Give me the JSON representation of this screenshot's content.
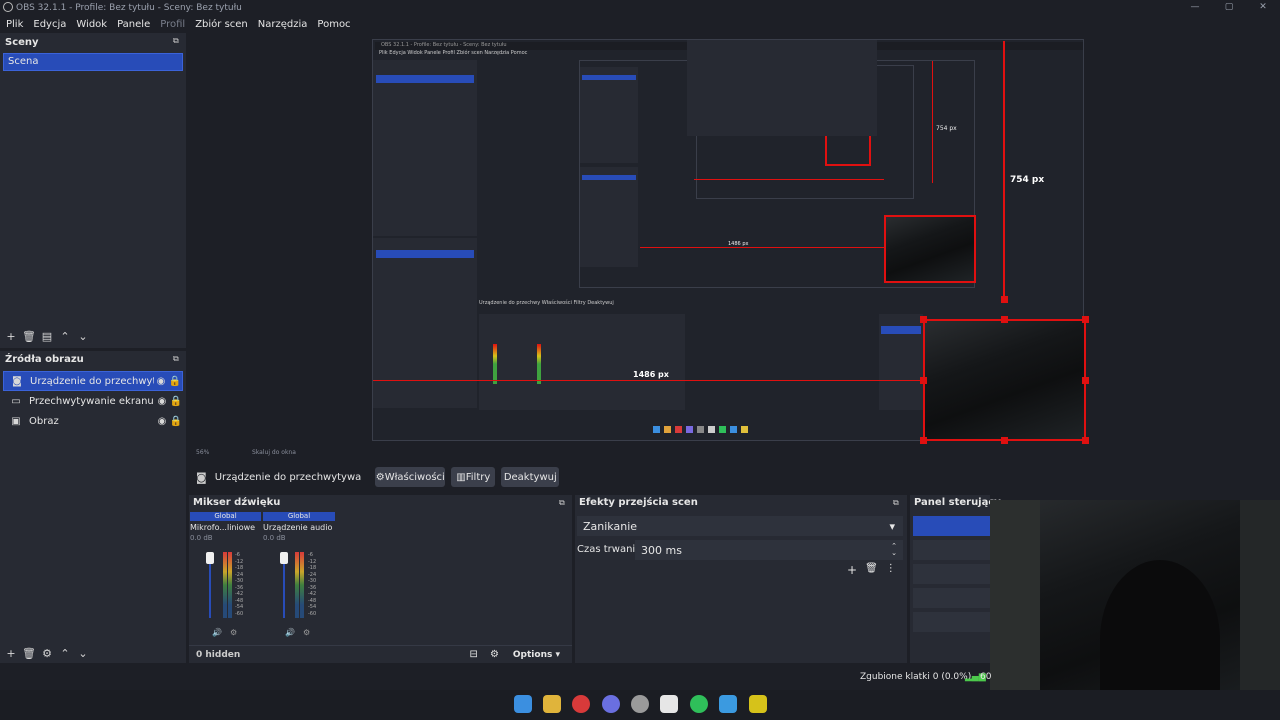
{
  "window": {
    "title": "OBS 32.1.1 - Profile: Bez tytułu - Sceny: Bez tytułu",
    "controls": [
      "—",
      "▢",
      "✕"
    ]
  },
  "menu": [
    "Plik",
    "Edycja",
    "Widok",
    "Panele",
    "Profil",
    "Zbiór scen",
    "Narzędzia",
    "Pomoc"
  ],
  "scenes": {
    "title": "Sceny",
    "items": [
      "Scena"
    ]
  },
  "sources": {
    "title": "Źródła obrazu",
    "items": [
      {
        "name": "Urządzenie do przechwytywan",
        "icon": "camera-icon"
      },
      {
        "name": "Przechwytywanie ekranu",
        "icon": "monitor-icon"
      },
      {
        "name": "Obraz",
        "icon": "image-icon"
      }
    ]
  },
  "preview": {
    "bottom_label": "Skaluj do okna",
    "zoom": "56%",
    "measure_height": "754 px",
    "measure_width": "1486 px",
    "inner_measure_height": "754 px",
    "inner_measure_width": "1486 px"
  },
  "context_bar": {
    "source": "Urządzenie do przechwytywa",
    "properties": "Właściwości",
    "filters": "Filtry",
    "deactivate": "Deaktywuj"
  },
  "mixer": {
    "title": "Mikser dźwięku",
    "channels": [
      {
        "badge": "Global",
        "name": "Mikrofo...liniowe",
        "db": "0.0 dB"
      },
      {
        "badge": "Global",
        "name": "Urządzenie audio",
        "db": "0.0 dB"
      }
    ],
    "scale": [
      "-6",
      "-12",
      "-18",
      "-24",
      "-30",
      "-36",
      "-42",
      "-48",
      "-54",
      "-60"
    ],
    "hidden": "0 hidden",
    "options": "Options"
  },
  "transitions": {
    "title": "Efekty przejścia scen",
    "selected": "Zanikanie",
    "duration_label": "Czas trwania",
    "duration_value": "300 ms"
  },
  "controls": {
    "title": "Panel sterujący"
  },
  "status": {
    "dropped": "Zgubione klatki 0 (0.0%)",
    "fps": "60"
  },
  "colors": {
    "accent": "#284cb8",
    "marker": "#e01010",
    "panel": "#272a33",
    "bg": "#1d1f26"
  }
}
